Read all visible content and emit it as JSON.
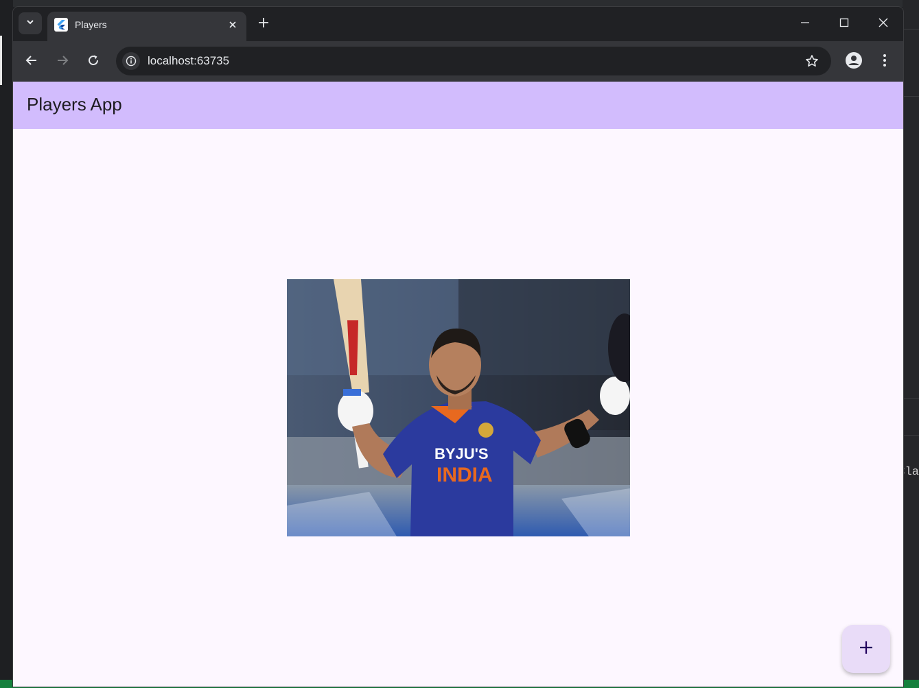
{
  "browser": {
    "tab_title": "Players",
    "url": "localhost:63735"
  },
  "app": {
    "title": "Players App",
    "fab_icon": "plus-icon"
  },
  "background_window": {
    "code_fragment": "Cla"
  },
  "colors": {
    "appbar": "#d2bcfd",
    "page_bg": "#fdf7ff",
    "fab": "#e9dcf8",
    "jersey": "#2b3a9e"
  }
}
